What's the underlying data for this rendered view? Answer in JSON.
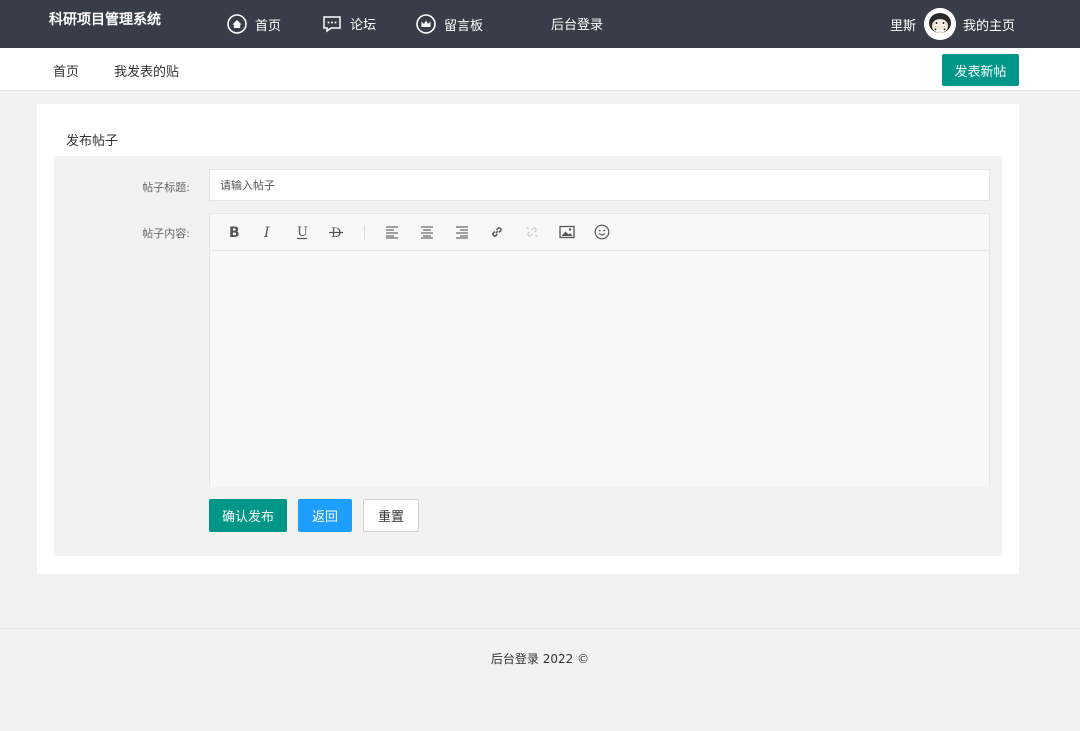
{
  "header": {
    "brand": "科研项目管理系统",
    "nav": [
      {
        "label": "首页",
        "icon": "home-icon"
      },
      {
        "label": "论坛",
        "icon": "chat-icon"
      },
      {
        "label": "留言板",
        "icon": "crown-icon"
      },
      {
        "label": "后台登录"
      }
    ],
    "user_name": "里斯",
    "my_home": "我的主页"
  },
  "subnav": {
    "home": "首页",
    "my_posts": "我发表的贴",
    "new_post": "发表新帖"
  },
  "form": {
    "card_title": "发布帖子",
    "title_label": "帖子标题:",
    "title_placeholder": "请输入帖子",
    "content_label": "帖子内容:",
    "toolbar": [
      "bold-icon",
      "italic-icon",
      "underline-icon",
      "strikethrough-icon",
      "align-left-icon",
      "align-center-icon",
      "align-right-icon",
      "link-icon",
      "unlink-icon",
      "image-icon",
      "emoji-icon"
    ],
    "confirm": "确认发布",
    "back": "返回",
    "reset": "重置"
  },
  "footer": {
    "text": "后台登录  2022 ©"
  },
  "colors": {
    "header_bg": "#393d49",
    "primary": "#009688",
    "blue": "#1e9fff"
  }
}
